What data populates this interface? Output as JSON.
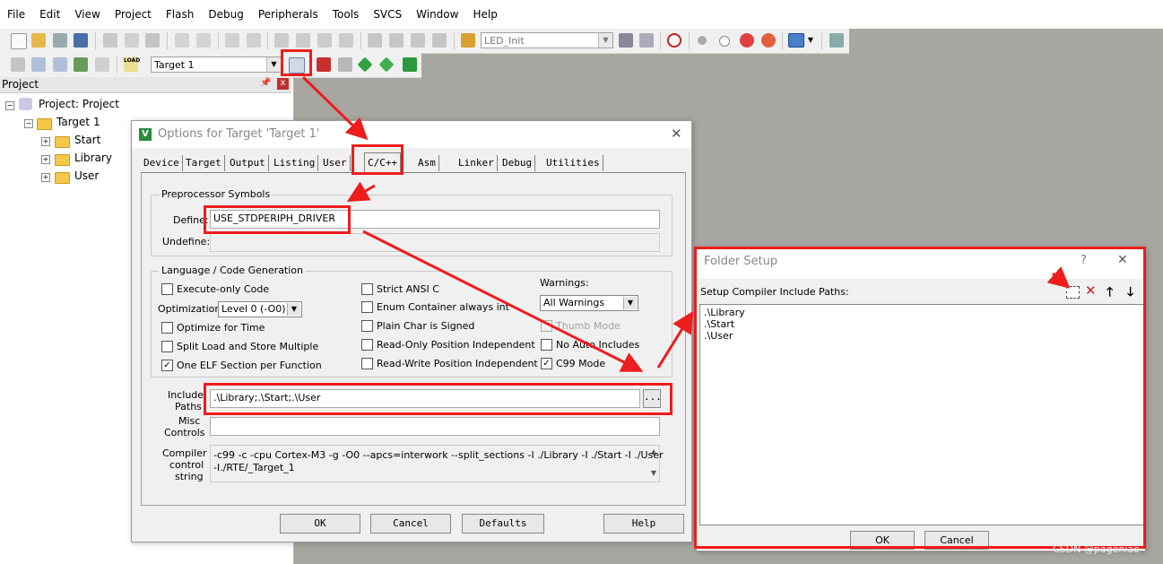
{
  "menu": [
    "File",
    "Edit",
    "View",
    "Project",
    "Flash",
    "Debug",
    "Peripherals",
    "Tools",
    "SVCS",
    "Window",
    "Help"
  ],
  "toolbar": {
    "combo1": "LED_Init",
    "target_combo": "Target 1",
    "load_icon_text": "LOAD"
  },
  "project_panel": {
    "title": "Project",
    "pin": " ▮",
    "close": "x",
    "root": "Project: Project",
    "target": "Target 1",
    "groups": [
      "Start",
      "Library",
      "User"
    ]
  },
  "options_dialog": {
    "title": "Options for Target 'Target 1'",
    "close": "✕",
    "tabs": [
      "Device",
      "Target",
      "Output",
      "Listing",
      "User",
      "C/C++",
      "Asm",
      "Linker",
      "Debug",
      "Utilities"
    ],
    "active_tab": "C/C++",
    "preprocessor": {
      "group_label": "Preprocessor Symbols",
      "define_label": "Define:",
      "define_value": "USE_STDPERIPH_DRIVER",
      "undefine_label": "Undefine:",
      "undefine_value": ""
    },
    "language": {
      "group_label": "Language / Code Generation",
      "execute_only": "Execute-only Code",
      "optimization_label": "Optimization:",
      "optimization_value": "Level 0 (-O0)",
      "optimize_time": "Optimize for Time",
      "split_load": "Split Load and Store Multiple",
      "one_elf": "One ELF Section per Function",
      "strict_ansi": "Strict ANSI C",
      "enum_container": "Enum Container always int",
      "plain_char": "Plain Char is Signed",
      "ro_position": "Read-Only Position Independent",
      "rw_position": "Read-Write Position Independent",
      "warnings_label": "Warnings:",
      "warnings_value": "All Warnings",
      "thumb_mode": "Thumb Mode",
      "no_auto_includes": "No Auto Includes",
      "c99_mode": "C99 Mode"
    },
    "include_paths_label_1": "Include",
    "include_paths_label_2": "Paths",
    "include_paths_value": ".\\Library;.\\Start;.\\User",
    "browse_button": "...",
    "misc_label_1": "Misc",
    "misc_label_2": "Controls",
    "misc_value": "",
    "compiler_label_1": "Compiler",
    "compiler_label_2": "control",
    "compiler_label_3": "string",
    "compiler_line_1": "-c99 -c -cpu Cortex-M3 -g -O0 --apcs=interwork --split_sections -I ./Library -I ./Start -I ./User",
    "compiler_line_2": "-I./RTE/_Target_1",
    "buttons": {
      "ok": "OK",
      "cancel": "Cancel",
      "defaults": "Defaults",
      "help": "Help"
    }
  },
  "folder_dialog": {
    "title": "Folder Setup",
    "help": "?",
    "close": "✕",
    "label": "Setup Compiler Include Paths:",
    "paths": [
      ".\\Library",
      ".\\Start",
      ".\\User"
    ],
    "buttons": {
      "ok": "OK",
      "cancel": "Cancel"
    }
  },
  "watermark": "CSDN @pageniao",
  "colors": {
    "annotation_red": "#ee1c1c",
    "workspace_gray": "#a8a6a0"
  }
}
